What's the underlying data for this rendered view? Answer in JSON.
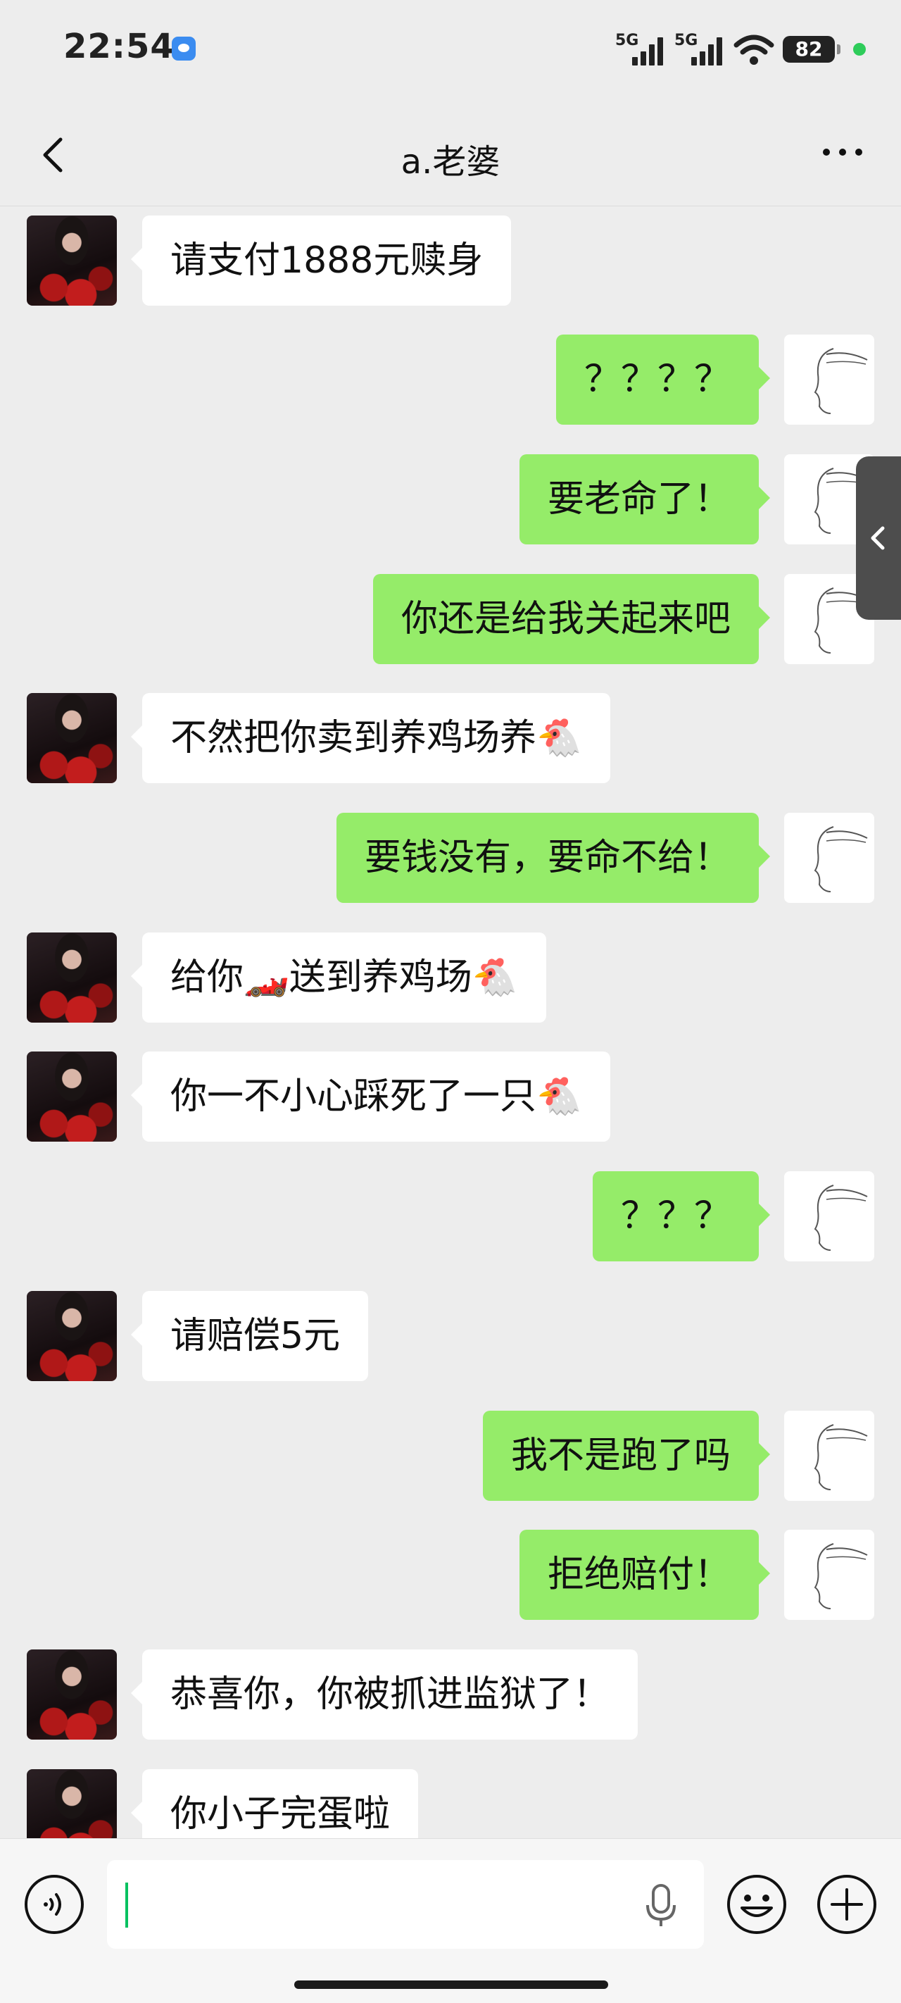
{
  "status_bar": {
    "time": "22:54",
    "network_1": "5G",
    "network_2": "5G",
    "battery": "82",
    "indicator_color": "#2ecc5a"
  },
  "nav": {
    "title": "a.老婆",
    "back_icon": "chevron-left-icon",
    "more_icon": "more-icon"
  },
  "colors": {
    "background": "#ededed",
    "incoming_bubble": "#ffffff",
    "outgoing_bubble": "#95ec69",
    "accent": "#07c160"
  },
  "messages": [
    {
      "side": "in",
      "text": "请支付1888元赎身"
    },
    {
      "side": "out",
      "text": "？？？？"
    },
    {
      "side": "out",
      "text": "要老命了！"
    },
    {
      "side": "out",
      "text": "你还是给我关起来吧"
    },
    {
      "side": "in",
      "text": "不然把你卖到养鸡场养🐔"
    },
    {
      "side": "out",
      "text": "要钱没有，要命不给！"
    },
    {
      "side": "in",
      "text": "给你🏎️送到养鸡场🐔"
    },
    {
      "side": "in",
      "text": "你一不小心踩死了一只🐔"
    },
    {
      "side": "out",
      "text": "？？？"
    },
    {
      "side": "in",
      "text": "请赔偿5元"
    },
    {
      "side": "out",
      "text": "我不是跑了吗"
    },
    {
      "side": "out",
      "text": "拒绝赔付！"
    },
    {
      "side": "in",
      "text": "恭喜你，你被抓进监狱了！"
    },
    {
      "side": "in",
      "text": "你小子完蛋啦"
    }
  ],
  "input_bar": {
    "value": "",
    "voice_icon": "voice-icon",
    "mic_icon": "microphone-icon",
    "emoji_icon": "emoji-icon",
    "plus_icon": "plus-icon"
  }
}
